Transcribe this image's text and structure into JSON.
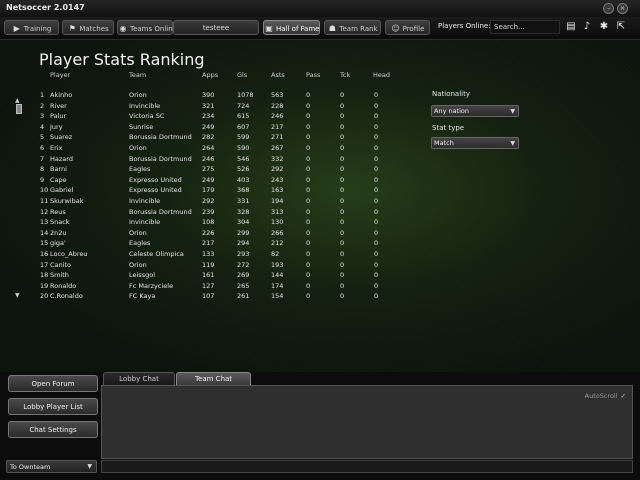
{
  "app": {
    "title": "Netsoccer 2.0147"
  },
  "nav": {
    "training": "Training",
    "matches": "Matches",
    "teams_online": "Teams Online",
    "username": "testeee",
    "hall_of_fame": "Hall of Fame",
    "team_rank": "Team Rank",
    "profile": "Profile",
    "players_online": "Players Online: 0",
    "search_placeholder": "Search..."
  },
  "page": {
    "title": "Player Stats Ranking"
  },
  "table": {
    "columns": [
      "Player",
      "Team",
      "Apps",
      "Gls",
      "Asts",
      "Pass",
      "Tck",
      "Head"
    ],
    "rows": [
      {
        "rank": "1",
        "player": "Akinho",
        "team": "Orion",
        "apps": "390",
        "gls": "1078",
        "asts": "563",
        "pass": "0",
        "tck": "0",
        "head": "0"
      },
      {
        "rank": "2",
        "player": "River",
        "team": "Invincible",
        "apps": "321",
        "gls": "724",
        "asts": "228",
        "pass": "0",
        "tck": "0",
        "head": "0"
      },
      {
        "rank": "3",
        "player": "Palur",
        "team": "Victoria SC",
        "apps": "234",
        "gls": "615",
        "asts": "246",
        "pass": "0",
        "tck": "0",
        "head": "0"
      },
      {
        "rank": "4",
        "player": "Jury",
        "team": "Sunrise",
        "apps": "249",
        "gls": "607",
        "asts": "217",
        "pass": "0",
        "tck": "0",
        "head": "0"
      },
      {
        "rank": "5",
        "player": "Suarez",
        "team": "Borussia Dortmund",
        "apps": "282",
        "gls": "599",
        "asts": "271",
        "pass": "0",
        "tck": "0",
        "head": "0"
      },
      {
        "rank": "6",
        "player": "Erix",
        "team": "Orion",
        "apps": "264",
        "gls": "590",
        "asts": "267",
        "pass": "0",
        "tck": "0",
        "head": "0"
      },
      {
        "rank": "7",
        "player": "Hazard",
        "team": "Borussia Dortmund",
        "apps": "246",
        "gls": "546",
        "asts": "332",
        "pass": "0",
        "tck": "0",
        "head": "0"
      },
      {
        "rank": "8",
        "player": "Barni",
        "team": "Eagles",
        "apps": "275",
        "gls": "526",
        "asts": "292",
        "pass": "0",
        "tck": "0",
        "head": "0"
      },
      {
        "rank": "9",
        "player": "Cape",
        "team": "Expresso United",
        "apps": "249",
        "gls": "403",
        "asts": "243",
        "pass": "0",
        "tck": "0",
        "head": "0"
      },
      {
        "rank": "10",
        "player": "Gabriel",
        "team": "Expresso United",
        "apps": "179",
        "gls": "368",
        "asts": "163",
        "pass": "0",
        "tck": "0",
        "head": "0"
      },
      {
        "rank": "11",
        "player": "Skurwibak",
        "team": "Invincible",
        "apps": "292",
        "gls": "331",
        "asts": "194",
        "pass": "0",
        "tck": "0",
        "head": "0"
      },
      {
        "rank": "12",
        "player": "Reus",
        "team": "Borussia Dortmund",
        "apps": "239",
        "gls": "328",
        "asts": "313",
        "pass": "0",
        "tck": "0",
        "head": "0"
      },
      {
        "rank": "13",
        "player": "Snack",
        "team": "Invincible",
        "apps": "108",
        "gls": "304",
        "asts": "130",
        "pass": "0",
        "tck": "0",
        "head": "0"
      },
      {
        "rank": "14",
        "player": "2n2u",
        "team": "Orion",
        "apps": "226",
        "gls": "299",
        "asts": "266",
        "pass": "0",
        "tck": "0",
        "head": "0"
      },
      {
        "rank": "15",
        "player": "giga'",
        "team": "Eagles",
        "apps": "217",
        "gls": "294",
        "asts": "212",
        "pass": "0",
        "tck": "0",
        "head": "0"
      },
      {
        "rank": "16",
        "player": "Loco_Abreu",
        "team": "Celeste Olimpica",
        "apps": "133",
        "gls": "293",
        "asts": "82",
        "pass": "0",
        "tck": "0",
        "head": "0"
      },
      {
        "rank": "17",
        "player": "Canito",
        "team": "Orion",
        "apps": "119",
        "gls": "272",
        "asts": "193",
        "pass": "0",
        "tck": "0",
        "head": "0"
      },
      {
        "rank": "18",
        "player": "Smith",
        "team": "Leissgol",
        "apps": "161",
        "gls": "269",
        "asts": "144",
        "pass": "0",
        "tck": "0",
        "head": "0"
      },
      {
        "rank": "19",
        "player": "Ronaldo",
        "team": "Fc Marzyciele",
        "apps": "127",
        "gls": "265",
        "asts": "174",
        "pass": "0",
        "tck": "0",
        "head": "0"
      },
      {
        "rank": "20",
        "player": "C.Ronaldo",
        "team": "FC Kaya",
        "apps": "107",
        "gls": "261",
        "asts": "154",
        "pass": "0",
        "tck": "0",
        "head": "0"
      }
    ]
  },
  "filters": {
    "nationality_label": "Nationality",
    "nationality_value": "Any nation",
    "stat_type_label": "Stat type",
    "stat_type_value": "Match"
  },
  "sidebar": {
    "open_forum": "Open Forum",
    "lobby_player_list": "Lobby Player List",
    "chat_settings": "Chat Settings"
  },
  "chat": {
    "tabs": [
      "Lobby Chat",
      "Team Chat"
    ],
    "active_tab": "Team Chat",
    "autoscroll": "AutoScroll",
    "target": "To Ownteam"
  },
  "colors": {
    "background": "#0c0c0c",
    "pitch": "#2a4a1c",
    "text": "#e6e6e6"
  },
  "icons": [
    "training-icon",
    "matches-icon",
    "teams-online-icon",
    "hall-of-fame-icon",
    "team-rank-icon",
    "profile-icon",
    "chat-icon",
    "notification-icon",
    "settings-icon",
    "exit-icon"
  ]
}
